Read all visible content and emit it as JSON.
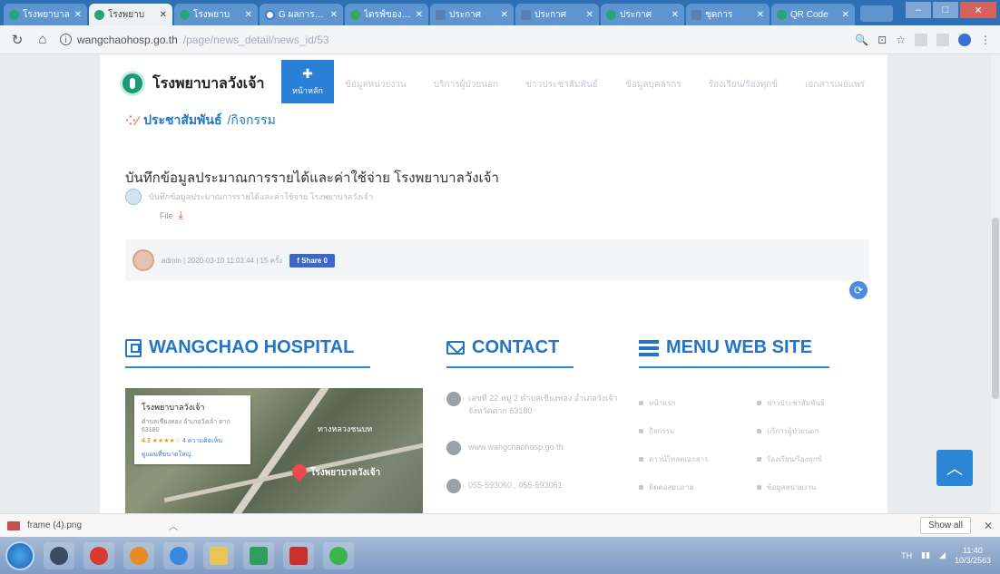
{
  "browser": {
    "tabs": [
      {
        "title": "โรงพยาบาล",
        "active": false,
        "icon": "hospital-icon"
      },
      {
        "title": "โรงพยาบ",
        "active": true,
        "icon": "hospital-icon"
      },
      {
        "title": "โรงพยาบ",
        "active": false,
        "icon": "hospital-icon"
      },
      {
        "title": "G ผลการค้นหา",
        "active": false,
        "icon": "google-icon"
      },
      {
        "title": "ไดรฟ์ของฉัน",
        "active": false,
        "icon": "drive-icon"
      },
      {
        "title": "ประกาศ",
        "active": false,
        "icon": "doc-icon"
      },
      {
        "title": "ประกาศ",
        "active": false,
        "icon": "doc-icon"
      },
      {
        "title": "ประกาศ",
        "active": false,
        "icon": "hospital-icon"
      },
      {
        "title": "ชุดการ",
        "active": false,
        "icon": "doc-icon"
      },
      {
        "title": "QR Code",
        "active": false,
        "icon": "qr-icon"
      }
    ],
    "url_host": "wangchaohosp.go.th",
    "url_path": "/page/news_detail/news_id/53"
  },
  "site": {
    "name": "โรงพยาบาลวังเจ้า",
    "home_label": "หน้าหลัก",
    "nav": [
      "ข้อมูลหน่วยงาน",
      "บริการผู้ป่วยนอก",
      "ข่าวประชาสัมพันธ์",
      "ข้อมูลบุคลากร",
      "ร้องเรียน/ร้องทุกข์",
      "เอกสารเผยแพร่"
    ],
    "breadcrumb": {
      "section": "ประชาสัมพันธ์",
      "sub": "/กิจกรรม"
    }
  },
  "article": {
    "title": "บันทึกข้อมูลประมาณการรายได้และค่าใช้จ่าย โรงพยาบาลวังเจ้า",
    "description": "บันทึกข้อมูลประมาณการรายได้และค่าใช้จ่าย โรงพยาบาลวังเจ้า",
    "file_label": "File",
    "meta": "admin | 2020-03-10 11:03:44 | 15 ครั้ง",
    "share_label": "f Share 0"
  },
  "footer": {
    "hospital_heading": "WANGCHAO HOSPITAL",
    "contact_heading": "CONTACT",
    "menu_heading": "MENU WEB SITE",
    "map": {
      "place": "โรงพยาบาลวังเจ้า",
      "address": "ตำบลเชียงทอง อำเภอวังเจ้า ตาก 63180",
      "rating": "4.3 ★★★★☆",
      "reviews": "4 ความคิดเห็น",
      "link": "ดูแผนที่ขนาดใหญ่",
      "road_label": "ทางหลวงชนบท",
      "pin_label": "โรงพยาบาลวังเจ้า"
    },
    "contacts": [
      {
        "icon": "location-icon",
        "text": "เลขที่ 22 หมู่ 2 ตำบลเชียงทอง อำเภอวังเจ้า จังหวัดตาก 63180"
      },
      {
        "icon": "globe-icon",
        "text": "www.wangchaohosp.go.th"
      },
      {
        "icon": "phone-icon",
        "text": "055-593060 , 055-593061"
      }
    ],
    "menu_items": [
      "หน้าแรก",
      "ข่าวประชาสัมพันธ์",
      "กิจกรรม",
      "บริการผู้ป่วยนอก",
      "ดาวน์โหลดเอกสาร",
      "ร้องเรียน/ร้องทุกข์",
      "ติดต่อสอบถาม",
      "ข้อมูลหน่วยงาน"
    ]
  },
  "download_bar": {
    "file": "frame (4).png",
    "show_all": "Show all"
  },
  "taskbar": {
    "lang": "TH",
    "time": "11:40",
    "date": "10/3/2563"
  }
}
